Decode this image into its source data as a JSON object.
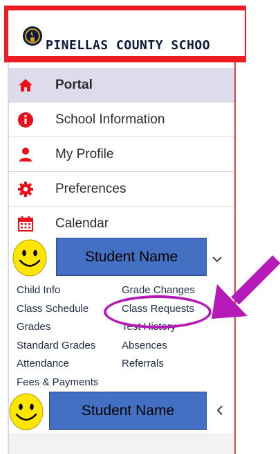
{
  "header": {
    "district_name": "PINELLAS COUNTY SCHOO"
  },
  "nav": {
    "items": [
      {
        "label": "Portal",
        "icon": "home-icon",
        "active": true
      },
      {
        "label": "School Information",
        "icon": "info-icon"
      },
      {
        "label": "My Profile",
        "icon": "user-icon"
      },
      {
        "label": "Preferences",
        "icon": "gear-icon"
      },
      {
        "label": "Calendar",
        "icon": "calendar-icon"
      }
    ]
  },
  "students": [
    {
      "name": "Student Name",
      "expanded": true,
      "chevron": "chevron-down-icon"
    },
    {
      "name": "Student Name",
      "expanded": false,
      "chevron": "chevron-left-icon"
    }
  ],
  "student_links": {
    "left": [
      "Child Info",
      "Class Schedule",
      "Grades",
      "Standard Grades",
      "Attendance",
      "Fees & Payments"
    ],
    "right": [
      "Grade Changes",
      "Class Requests",
      "Test History",
      "Absences",
      "Referrals"
    ]
  },
  "colors": {
    "header_red": "#ee1c24",
    "icon_red": "#e8101a",
    "active_bg": "#dddcec",
    "name_box_blue": "#4470c4",
    "annotation_magenta": "#b51ab8"
  }
}
